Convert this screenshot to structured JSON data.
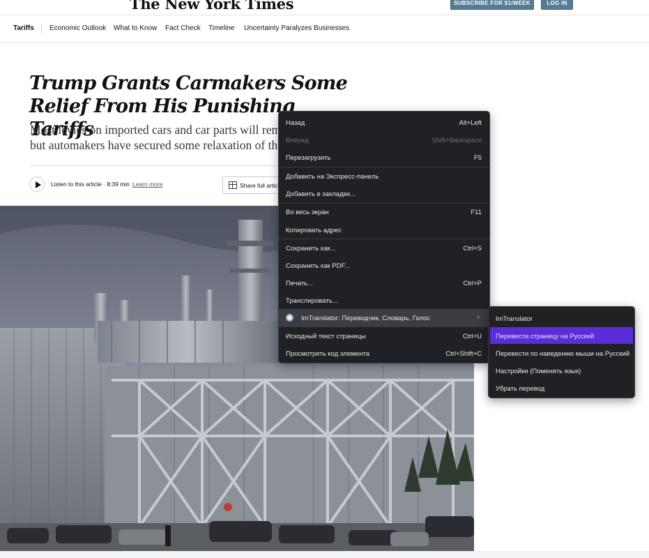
{
  "masthead": {
    "logo": "The New York Times",
    "subscribe_label": "SUBSCRIBE FOR $1/WEEK",
    "login_label": "LOG IN"
  },
  "subnav": {
    "items": [
      "Tariffs",
      "Economic Outlook",
      "What to Know",
      "Fact Check",
      "Timeline",
      "Uncertainty Paralyzes Businesses"
    ]
  },
  "article": {
    "headline": "Trump Grants Carmakers Some Relief From His Punishing Tariffs",
    "summary_line1": "Most levies on imported cars and car parts will remain in",
    "summary_line2": "but automakers have secured some relaxation of the tra",
    "listen_label": "Listen to this article · 8:39 min",
    "learn_more": "Learn more",
    "share_label": "Share full article"
  },
  "context_menu": {
    "items": [
      {
        "label": "Назад",
        "shortcut": "Alt+Left",
        "disabled": false
      },
      {
        "label": "Вперед",
        "shortcut": "Shift+Backspace",
        "disabled": true
      },
      {
        "label": "Перезагрузить",
        "shortcut": "F5",
        "disabled": false
      },
      {
        "label": "Добавить на Экспресс-панель",
        "shortcut": "",
        "disabled": false
      },
      {
        "label": "Добавить в закладки...",
        "shortcut": "",
        "disabled": false
      },
      {
        "label": "Во весь экран",
        "shortcut": "F11",
        "disabled": false
      },
      {
        "label": "Копировать адрес",
        "shortcut": "",
        "disabled": false
      },
      {
        "label": "Сохранить как...",
        "shortcut": "Ctrl+S",
        "disabled": false
      },
      {
        "label": "Сохранить как PDF...",
        "shortcut": "",
        "disabled": false
      },
      {
        "label": "Печать...",
        "shortcut": "Ctrl+P",
        "disabled": false
      },
      {
        "label": "Транслировать...",
        "shortcut": "",
        "disabled": false
      },
      {
        "label": "ImTranslator: Переводчик, Словарь, Голос",
        "shortcut": "",
        "disabled": false,
        "highlighted": true,
        "has_submenu": true,
        "icon": "imtranslator-icon"
      },
      {
        "label": "Исходный текст страницы",
        "shortcut": "Ctrl+U",
        "disabled": false
      },
      {
        "label": "Просмотреть код элемента",
        "shortcut": "Ctrl+Shift+C",
        "disabled": false
      }
    ]
  },
  "submenu": {
    "items": [
      {
        "label": "ImTranslator",
        "active": false
      },
      {
        "label": "Перевести страницу на Русский",
        "active": true
      },
      {
        "label": "Перевести по наведению мыши на Русский",
        "active": false
      },
      {
        "label": "Настройки (Поменять язык)",
        "active": false
      },
      {
        "label": "Убрать перевод",
        "active": false
      }
    ]
  },
  "colors": {
    "menu_bg": "#202124",
    "menu_highlight": "#3c3d41",
    "submenu_active": "#5b2dd8",
    "button_blue": "#567b95"
  }
}
